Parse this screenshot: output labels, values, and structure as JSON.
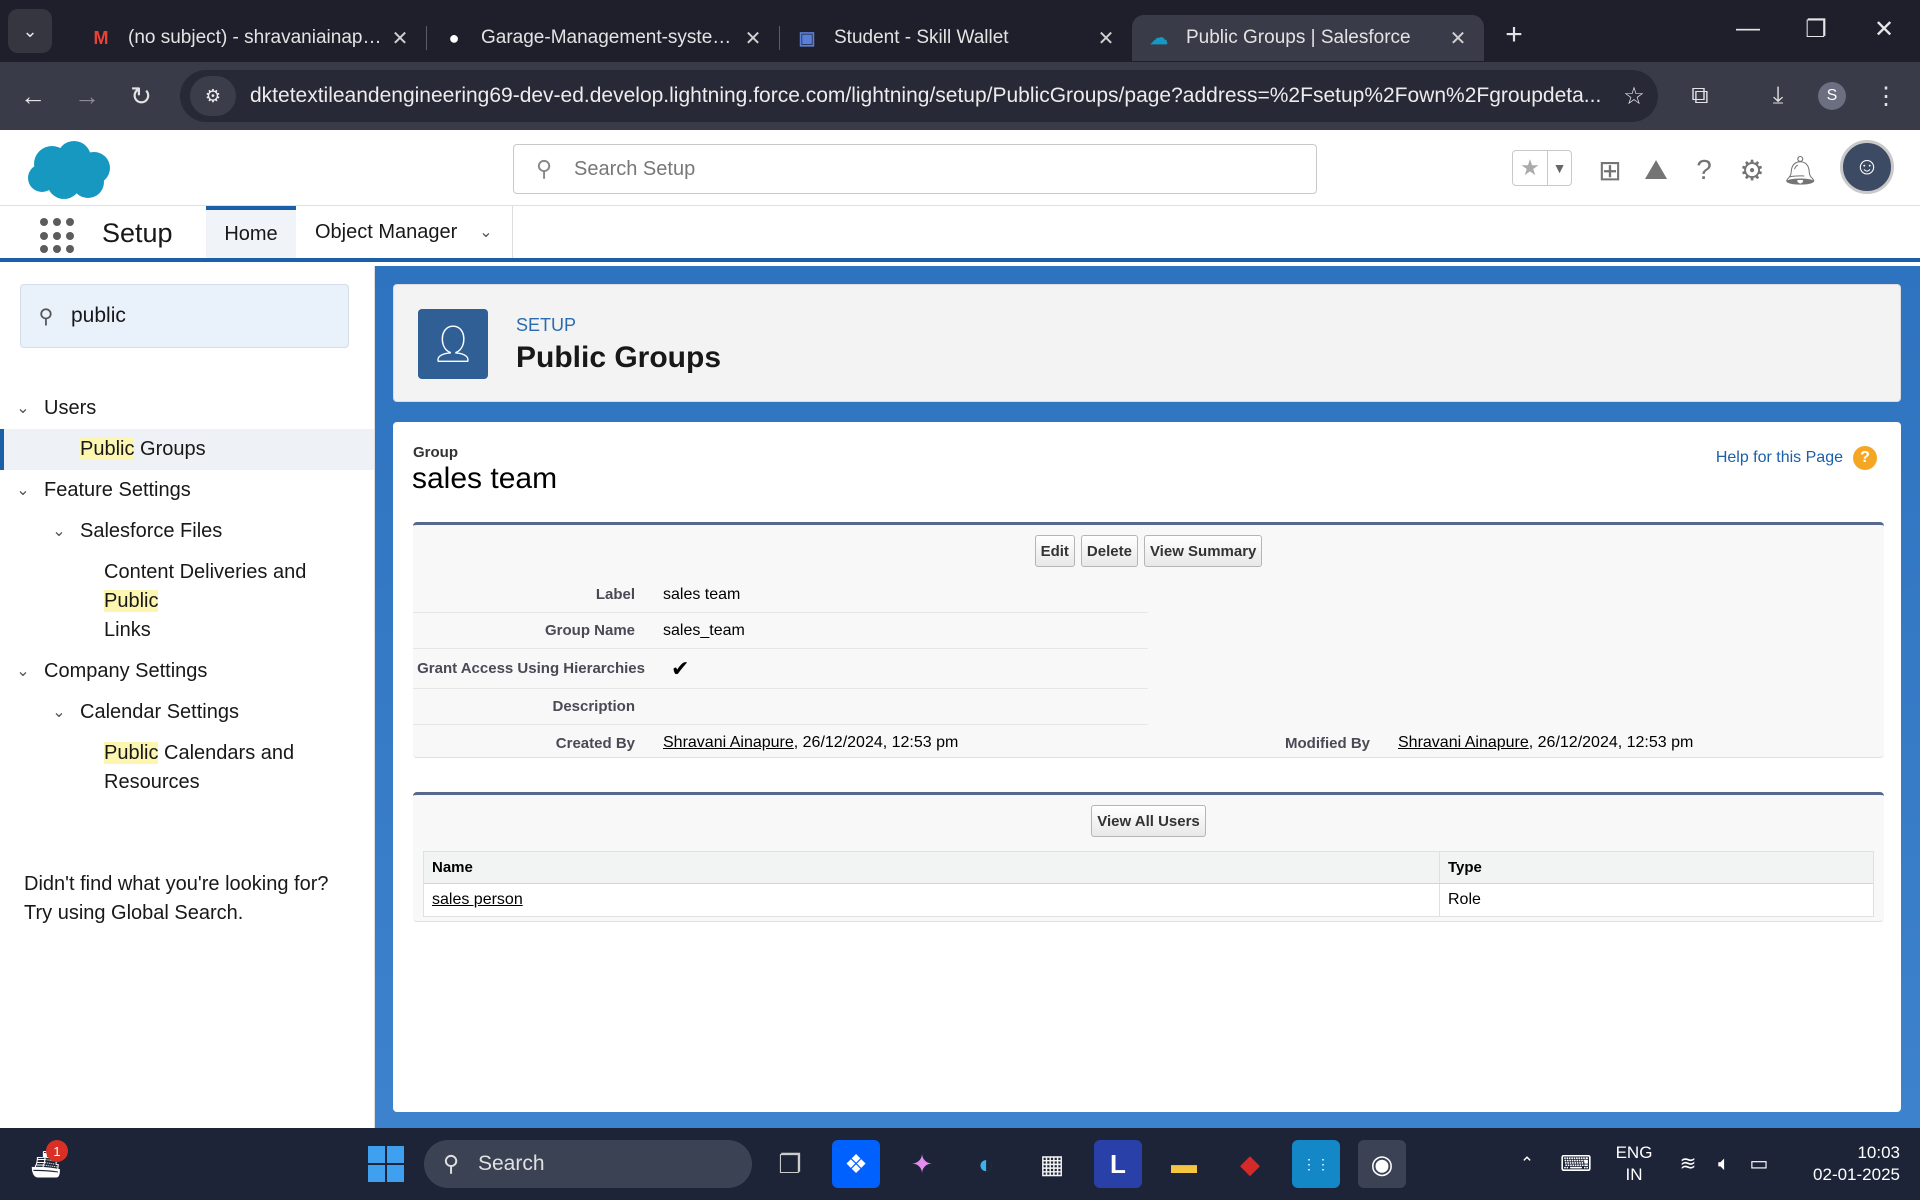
{
  "browser": {
    "tabs": [
      {
        "title": "(no subject) - shravaniainapure(",
        "icon": "gmail-icon",
        "active": false
      },
      {
        "title": "Garage-Management-system/P",
        "icon": "github-icon",
        "active": false
      },
      {
        "title": "Student - Skill Wallet",
        "icon": "skillwallet-icon",
        "active": false
      },
      {
        "title": "Public Groups | Salesforce",
        "icon": "salesforce-icon",
        "active": true
      }
    ],
    "url": "dktetextileandengineering69-dev-ed.develop.lightning.force.com/lightning/setup/PublicGroups/page?address=%2Fsetup%2Fown%2Fgroupdeta...",
    "profile_initial": "S"
  },
  "sf": {
    "search_placeholder": "Search Setup",
    "app_name": "Setup",
    "nav_tabs": [
      "Home",
      "Object Manager"
    ]
  },
  "sidebar": {
    "search_value": "public",
    "tree": {
      "users": "Users",
      "public_groups_hl": "Public",
      "public_groups_rest": " Groups",
      "feature_settings": "Feature Settings",
      "salesforce_files": "Salesforce Files",
      "content_deliveries_pre": "Content Deliveries and ",
      "content_deliveries_hl": "Public",
      "content_deliveries_post": "Links",
      "company_settings": "Company Settings",
      "calendar_settings": "Calendar Settings",
      "public_calendars_hl": "Public",
      "public_calendars_post": " Calendars and",
      "public_calendars_line2": "Resources"
    },
    "not_found_line1": "Didn't find what you're looking for?",
    "not_found_line2": "Try using Global Search."
  },
  "page_header": {
    "eyebrow": "SETUP",
    "title": "Public Groups"
  },
  "group": {
    "eyebrow": "Group",
    "title": "sales team",
    "help_link": "Help for this Page",
    "buttons": {
      "edit": "Edit",
      "delete": "Delete",
      "view_summary": "View Summary"
    },
    "fields": {
      "label_lbl": "Label",
      "label_val": "sales team",
      "name_lbl": "Group Name",
      "name_val": "sales_team",
      "grant_lbl": "Grant Access Using Hierarchies",
      "grant_val": "✔",
      "desc_lbl": "Description",
      "desc_val": "",
      "created_lbl": "Created By",
      "created_user": "Shravani Ainapure",
      "created_date": ", 26/12/2024, 12:53 pm",
      "modified_lbl": "Modified By",
      "modified_user": "Shravani Ainapure",
      "modified_date": ", 26/12/2024, 12:53 pm"
    }
  },
  "members": {
    "view_all_button": "View All Users",
    "headers": {
      "name": "Name",
      "type": "Type"
    },
    "rows": [
      {
        "name": "sales person",
        "type": "Role"
      }
    ]
  },
  "taskbar": {
    "search_label": "Search",
    "notification_count": "1",
    "lang_line1": "ENG",
    "lang_line2": "IN",
    "time": "10:03",
    "date": "02-01-2025"
  }
}
